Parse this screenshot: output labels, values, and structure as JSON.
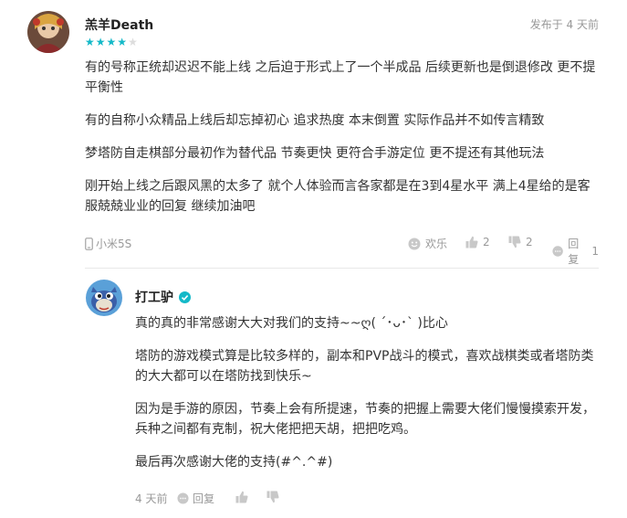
{
  "review": {
    "username": "羔羊Death",
    "posted": "发布于 4 天前",
    "rating": 4,
    "rating_max": 5,
    "star_color": "#14b9c8",
    "star_empty_color": "#dddddd",
    "paragraphs": [
      "有的号称正统却迟迟不能上线 之后迫于形式上了一个半成品 后续更新也是倒退修改 更不提平衡性",
      "有的自称小众精品上线后却忘掉初心 追求热度 本末倒置 实际作品并不如传言精致",
      "梦塔防自走棋部分最初作为替代品 节奏更快 更符合手游定位 更不提还有其他玩法",
      "刚开始上线之后跟风黑的太多了 就个人体验而言各家都是在3到4星水平 满上4星给的是客服兢兢业业的回复 继续加油吧"
    ],
    "device": "小米5S",
    "actions": {
      "fun_label": "欢乐",
      "like_count": "2",
      "dislike_count": "2",
      "reply_label": "回复",
      "reply_count": "1"
    }
  },
  "developer_reply": {
    "name": "打工驴",
    "verified_color": "#14b9c8",
    "paragraphs": [
      "真的真的非常感谢大大对我们的支持~~ღ( ´･ᴗ･` )比心",
      "塔防的游戏模式算是比较多样的，副本和PVP战斗的模式，喜欢战棋类或者塔防类的大大都可以在塔防找到快乐~",
      "因为是手游的原因，节奏上会有所提速，节奏的把握上需要大佬们慢慢摸索开发，兵种之间都有克制，祝大佬把把天胡，把把吃鸡。",
      "最后再次感谢大佬的支持(#^.^#)"
    ],
    "time": "4 天前",
    "reply_label": "回复"
  }
}
